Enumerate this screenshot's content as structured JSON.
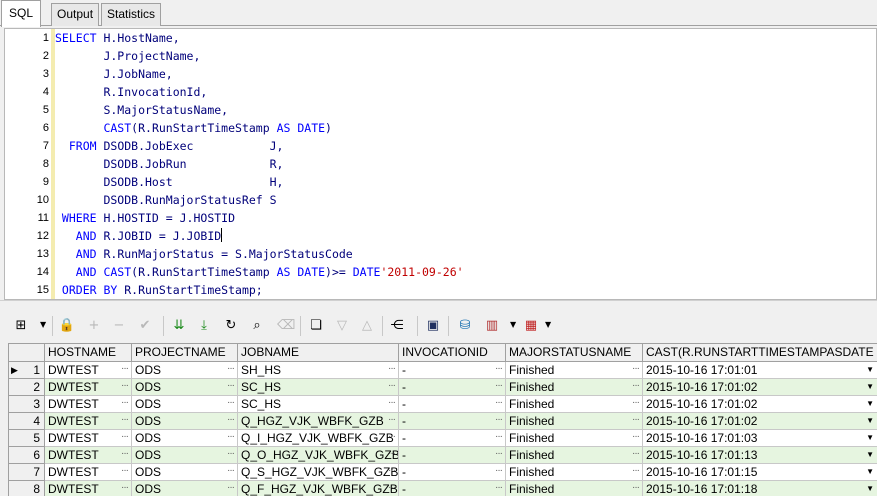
{
  "tabs": [
    {
      "label": "SQL"
    },
    {
      "label": "Output"
    },
    {
      "label": "Statistics"
    }
  ],
  "editor": {
    "lines": [
      {
        "n": "1",
        "segs": [
          [
            "kw",
            "SELECT "
          ],
          [
            "id",
            "H.HostName,"
          ]
        ]
      },
      {
        "n": "2",
        "segs": [
          [
            "id",
            "       J.ProjectName,"
          ]
        ]
      },
      {
        "n": "3",
        "segs": [
          [
            "id",
            "       J.JobName,"
          ]
        ]
      },
      {
        "n": "4",
        "segs": [
          [
            "id",
            "       R.InvocationId,"
          ]
        ]
      },
      {
        "n": "5",
        "segs": [
          [
            "id",
            "       S.MajorStatusName,"
          ]
        ]
      },
      {
        "n": "6",
        "segs": [
          [
            "kw",
            "       CAST"
          ],
          [
            "id",
            "(R.RunStartTimeStamp "
          ],
          [
            "kw",
            "AS DATE"
          ],
          [
            "id",
            ")"
          ]
        ]
      },
      {
        "n": "7",
        "segs": [
          [
            "kw",
            "  FROM "
          ],
          [
            "id",
            "DSODB.JobExec           J,"
          ]
        ]
      },
      {
        "n": "8",
        "segs": [
          [
            "id",
            "       DSODB.JobRun            R,"
          ]
        ]
      },
      {
        "n": "9",
        "segs": [
          [
            "id",
            "       DSODB.Host              H,"
          ]
        ]
      },
      {
        "n": "10",
        "segs": [
          [
            "id",
            "       DSODB.RunMajorStatusRef S"
          ]
        ]
      },
      {
        "n": "11",
        "segs": [
          [
            "kw",
            " WHERE "
          ],
          [
            "id",
            "H.HOSTID = J.HOSTID"
          ]
        ]
      },
      {
        "n": "12",
        "segs": [
          [
            "kw",
            "   AND "
          ],
          [
            "id",
            "R.JOBID = J.JOBID"
          ],
          [
            "cursor",
            ""
          ]
        ]
      },
      {
        "n": "13",
        "segs": [
          [
            "kw",
            "   AND "
          ],
          [
            "id",
            "R.RunMajorStatus = S.MajorStatusCode"
          ]
        ]
      },
      {
        "n": "14",
        "segs": [
          [
            "kw",
            "   AND CAST"
          ],
          [
            "id",
            "(R.RunStartTimeStamp "
          ],
          [
            "kw",
            "AS DATE"
          ],
          [
            "id",
            ")>= "
          ],
          [
            "kw",
            "DATE"
          ],
          [
            "str",
            "'2011-09-26'"
          ]
        ]
      },
      {
        "n": "15",
        "segs": [
          [
            "kw",
            " ORDER BY "
          ],
          [
            "id",
            "R.RunStartTimeStamp;"
          ]
        ]
      }
    ]
  },
  "toolbar": {
    "icons": [
      {
        "name": "grid-view-icon",
        "glyph": "⊞",
        "enabled": true
      },
      {
        "name": "lock-icon",
        "glyph": "🔒",
        "enabled": true
      },
      {
        "name": "add-record-icon",
        "glyph": "+",
        "enabled": false
      },
      {
        "name": "delete-record-icon",
        "glyph": "−",
        "enabled": false
      },
      {
        "name": "post-changes-icon",
        "glyph": "✔",
        "enabled": false
      },
      {
        "name": "fetch-next-page-icon",
        "glyph": "⇊",
        "enabled": true
      },
      {
        "name": "fetch-last-page-icon",
        "glyph": "⤓",
        "enabled": true
      },
      {
        "name": "refresh-icon",
        "glyph": "↻",
        "enabled": true
      },
      {
        "name": "binoculars-find-icon",
        "glyph": "⌕",
        "enabled": true
      },
      {
        "name": "clear-icon",
        "glyph": "⌫",
        "enabled": false
      },
      {
        "name": "query-by-example-icon",
        "glyph": "❏",
        "enabled": true
      },
      {
        "name": "next-record-icon",
        "glyph": "▽",
        "enabled": false
      },
      {
        "name": "previous-record-icon",
        "glyph": "△",
        "enabled": false
      },
      {
        "name": "explain-plan-icon",
        "glyph": "⋲",
        "enabled": true
      },
      {
        "name": "save-icon",
        "glyph": "▣",
        "enabled": true
      },
      {
        "name": "export-icon",
        "glyph": "⛁",
        "enabled": true
      },
      {
        "name": "chart-icon",
        "glyph": "▥",
        "enabled": true
      },
      {
        "name": "table-options-icon",
        "glyph": "▦",
        "enabled": true
      }
    ]
  },
  "grid": {
    "columns": [
      "HOSTNAME",
      "PROJECTNAME",
      "JOBNAME",
      "INVOCATIONID",
      "MAJORSTATUSNAME",
      "CAST(R.RUNSTARTTIMESTAMPASDATE"
    ],
    "rows": [
      {
        "n": "1",
        "current": true,
        "cells": [
          "DWTEST",
          "ODS",
          "SH_HS",
          "-",
          "Finished",
          "2015-10-16 17:01:01"
        ]
      },
      {
        "n": "2",
        "current": false,
        "cells": [
          "DWTEST",
          "ODS",
          "SC_HS",
          "-",
          "Finished",
          "2015-10-16 17:01:02"
        ]
      },
      {
        "n": "3",
        "current": false,
        "cells": [
          "DWTEST",
          "ODS",
          "SC_HS",
          "-",
          "Finished",
          "2015-10-16 17:01:02"
        ]
      },
      {
        "n": "4",
        "current": false,
        "cells": [
          "DWTEST",
          "ODS",
          "Q_HGZ_VJK_WBFK_GZB",
          "-",
          "Finished",
          "2015-10-16 17:01:02"
        ]
      },
      {
        "n": "5",
        "current": false,
        "cells": [
          "DWTEST",
          "ODS",
          "Q_I_HGZ_VJK_WBFK_GZB",
          "-",
          "Finished",
          "2015-10-16 17:01:03"
        ]
      },
      {
        "n": "6",
        "current": false,
        "cells": [
          "DWTEST",
          "ODS",
          "Q_O_HGZ_VJK_WBFK_GZB",
          "-",
          "Finished",
          "2015-10-16 17:01:13"
        ]
      },
      {
        "n": "7",
        "current": false,
        "cells": [
          "DWTEST",
          "ODS",
          "Q_S_HGZ_VJK_WBFK_GZB",
          "-",
          "Finished",
          "2015-10-16 17:01:15"
        ]
      },
      {
        "n": "8",
        "current": false,
        "cells": [
          "DWTEST",
          "ODS",
          "Q_F_HGZ_VJK_WBFK_GZB",
          "-",
          "Finished",
          "2015-10-16 17:01:18"
        ]
      }
    ]
  }
}
